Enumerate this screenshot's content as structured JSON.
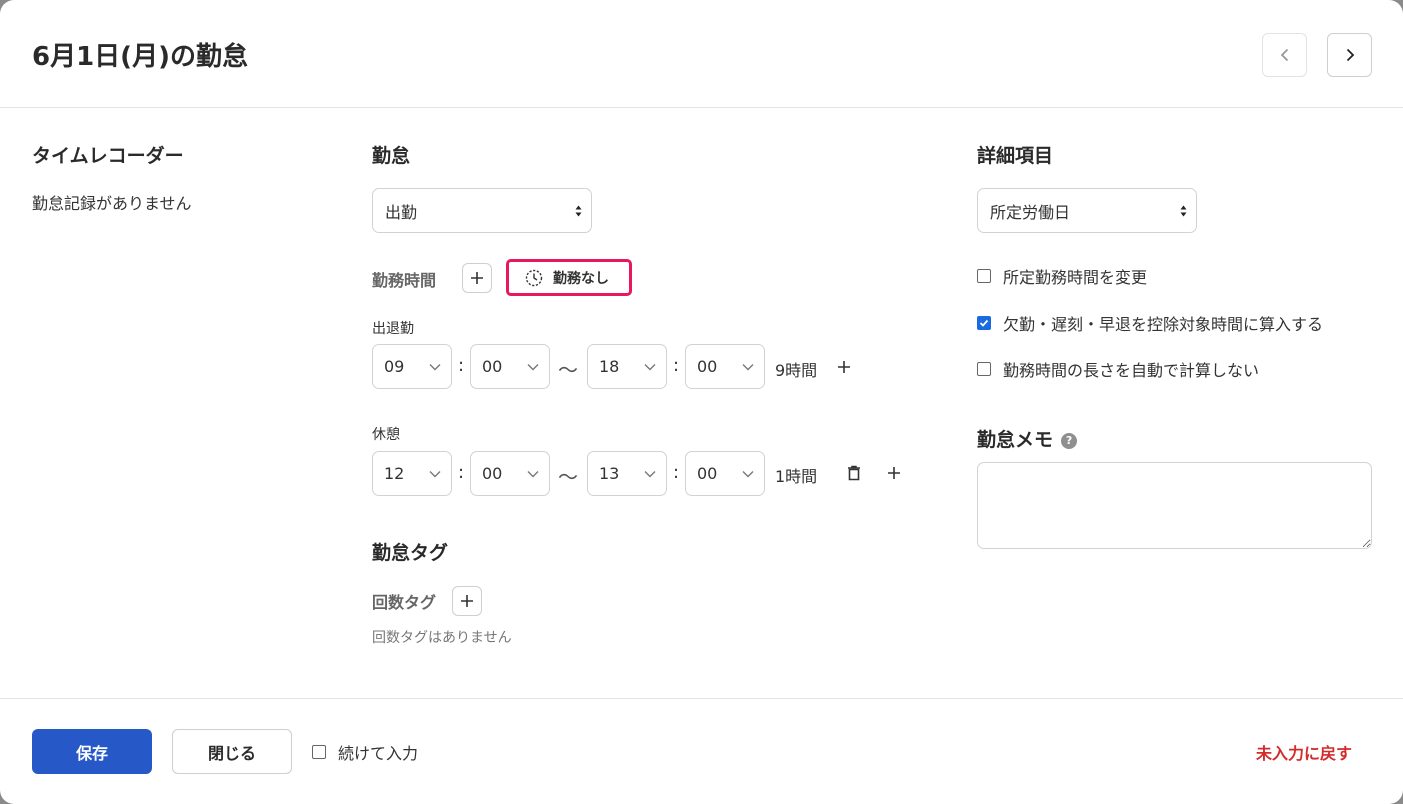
{
  "header": {
    "title": "6月1日(月)の勤怠",
    "prev_icon": "chevron-left-icon",
    "next_icon": "chevron-right-icon"
  },
  "time_recorder": {
    "title": "タイムレコーダー",
    "empty_text": "勤怠記録がありません"
  },
  "attendance": {
    "title": "勤怠",
    "type_value": "出勤",
    "work_time_label": "勤務時間",
    "no_work_label": "勤務なし",
    "shift": {
      "label": "出退勤",
      "start_hour": "09",
      "start_min": "00",
      "tilde": "～",
      "end_hour": "18",
      "end_min": "00",
      "duration": "9時間"
    },
    "break": {
      "label": "休憩",
      "start_hour": "12",
      "start_min": "00",
      "tilde": "～",
      "end_hour": "13",
      "end_min": "00",
      "duration": "1時間"
    },
    "colon": ":"
  },
  "tags": {
    "title": "勤怠タグ",
    "count_tag_label": "回数タグ",
    "empty_text": "回数タグはありません"
  },
  "details": {
    "title": "詳細項目",
    "day_type_value": "所定労働日",
    "checkboxes": [
      {
        "label": "所定勤務時間を変更",
        "checked": false
      },
      {
        "label": "欠勤・遅刻・早退を控除対象時間に算入する",
        "checked": true
      },
      {
        "label": "勤務時間の長さを自動で計算しない",
        "checked": false
      }
    ]
  },
  "memo": {
    "title": "勤怠メモ",
    "help_icon": "help-icon",
    "value": ""
  },
  "footer": {
    "save_label": "保存",
    "close_label": "閉じる",
    "continue_label": "続けて入力",
    "continue_checked": false,
    "back_label": "未入力に戻す"
  },
  "colors": {
    "primary": "#2658c8",
    "danger": "#d42b2b",
    "highlight": "#e8185f",
    "checkbox": "#1a6be0"
  }
}
